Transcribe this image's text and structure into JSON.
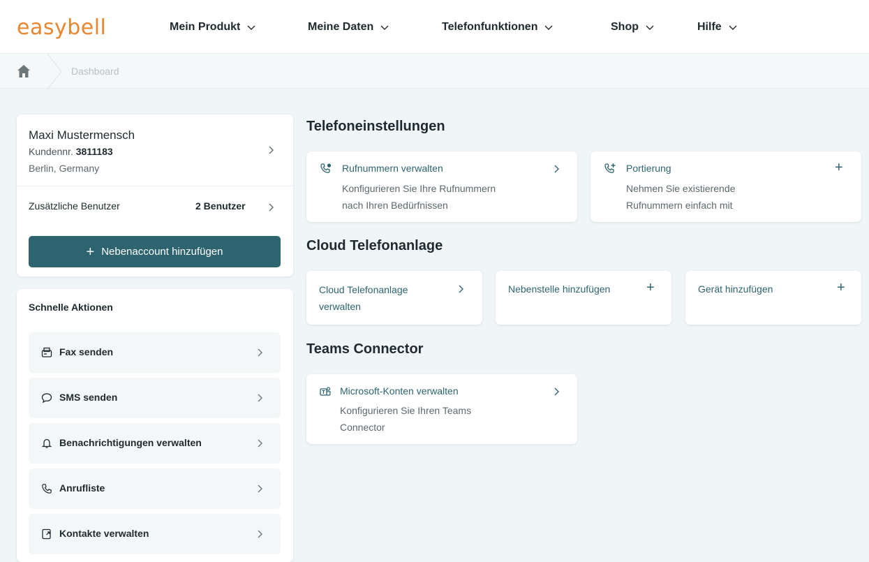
{
  "brand": {
    "logo": "easybell",
    "accent_color": "#e8872f",
    "primary_color": "#2d6470"
  },
  "nav": {
    "items": [
      {
        "label": "Mein Produkt"
      },
      {
        "label": "Meine Daten"
      },
      {
        "label": "Telefonfunktionen"
      },
      {
        "label": "Shop"
      },
      {
        "label": "Hilfe"
      }
    ]
  },
  "breadcrumb": {
    "home_icon": "home-icon",
    "current": "Dashboard"
  },
  "user": {
    "name": "Maxi Mustermensch",
    "customer_prefix": "Kundennr.",
    "customer_number": "3811183",
    "location": "Berlin, Germany",
    "extra_users_label": "Zusätzliche Benutzer",
    "extra_users_value": "2 Benutzer",
    "add_account_label": "Nebenaccount hinzufügen"
  },
  "quick_actions": {
    "title": "Schnelle Aktionen",
    "items": [
      {
        "label": "Fax senden",
        "icon": "fax-icon"
      },
      {
        "label": "SMS senden",
        "icon": "message-icon"
      },
      {
        "label": "Benachrichtigungen verwalten",
        "icon": "bell-icon"
      },
      {
        "label": "Anrufliste",
        "icon": "phone-icon"
      },
      {
        "label": "Kontakte verwalten",
        "icon": "contacts-icon"
      }
    ]
  },
  "sections": {
    "phone_settings": {
      "title": "Telefoneinstellungen",
      "tiles": [
        {
          "title": "Rufnummern verwalten",
          "desc_line1": "Konfigurieren Sie Ihre Rufnummern",
          "desc_line2": "nach Ihren Bedürfnissen",
          "icon": "phone-settings-icon",
          "action": "chevron"
        },
        {
          "title": "Portierung",
          "desc_line1": "Nehmen Sie existierende",
          "desc_line2": "Rufnummern einfach mit",
          "icon": "phone-plus-icon",
          "action": "plus"
        }
      ]
    },
    "cloud": {
      "title": "Cloud Telefonanlage",
      "tiles": [
        {
          "title_line1": "Cloud Telefonanlage",
          "title_line2": "verwalten",
          "action": "chevron"
        },
        {
          "title": "Nebenstelle hinzufügen",
          "action": "plus"
        },
        {
          "title": "Gerät hinzufügen",
          "action": "plus"
        }
      ]
    },
    "teams": {
      "title": "Teams Connector",
      "tiles": [
        {
          "title": "Microsoft-Konten verwalten",
          "desc_line1": "Konfigurieren Sie Ihren Teams",
          "desc_line2": "Connector",
          "icon": "teams-icon",
          "action": "chevron"
        }
      ]
    }
  }
}
